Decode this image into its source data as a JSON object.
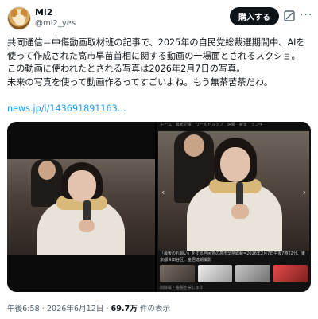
{
  "author": {
    "name": "Mi2",
    "handle": "@mi2_yes"
  },
  "actions": {
    "buy_label": "購入する",
    "grok_icon": "grok-icon",
    "more_icon": "more-icon"
  },
  "tweet": {
    "lines": [
      "共同通信＝中傷動画取材班の記事で、2025年の自民党総裁選期間中、AIを",
      "使って作成された高市早苗首相に関する動画の一場面とされるスクショ。",
      "この動画に使われたとされる写真は2026年2月7日の写真。",
      "未来の写真を使って動画作るってすごいよね。もう無茶苦茶だわ。"
    ],
    "link": "news.jp/i/143691891163..."
  },
  "media": {
    "right_tabs": "ホーム　最新記事　ワールドカップ　速報　新年　ランキ",
    "caption": "「最後のお願い」をする自民党の高市早苗総裁=2026年2月7日午後7時22分、東京都世田谷区、金居達朗撮影",
    "notice": "削除載・複製を禁じます"
  },
  "meta": {
    "time": "午後6:58 · 2026年6月12日 · ",
    "views": "69.7万",
    "views_suffix": " 件の表示"
  }
}
